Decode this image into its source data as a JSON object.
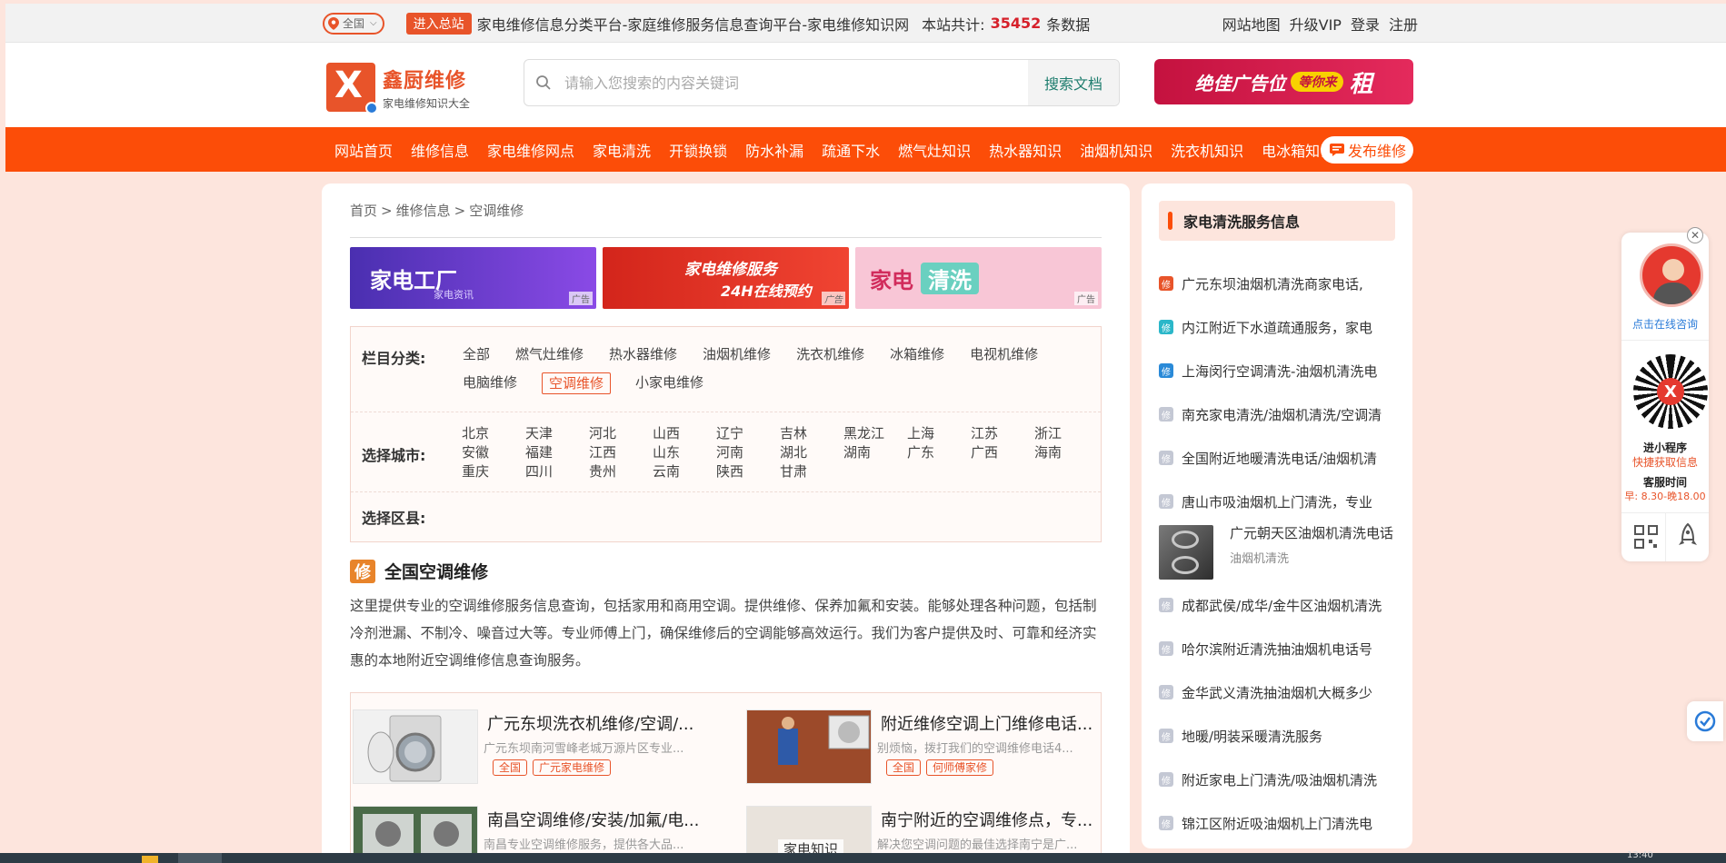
{
  "topbar": {
    "region": "全国",
    "enter_label": "进入总站",
    "description": "家电维修信息分类平台-家庭维修服务信息查询平台-家电维修知识网",
    "count_label": "本站共计:",
    "count_value": "35452",
    "count_unit": "条数据",
    "links": [
      "网站地图",
      "升级VIP",
      "登录",
      "注册"
    ]
  },
  "header": {
    "logo_title": "鑫厨维修",
    "logo_sub": "家电维修知识大全",
    "search_placeholder": "请输入您搜索的内容关键词",
    "search_button": "搜索文档",
    "ad_text_1": "绝佳广告位",
    "ad_text_2": "等你来",
    "ad_text_3": "租"
  },
  "nav": {
    "items": [
      "网站首页",
      "维修信息",
      "家电维修网点",
      "家电清洗",
      "开锁换锁",
      "防水补漏",
      "疏通下水",
      "燃气灶知识",
      "热水器知识",
      "油烟机知识",
      "洗衣机知识",
      "电冰箱知识"
    ],
    "publish": "发布维修"
  },
  "breadcrumb": [
    "首页",
    "维修信息",
    "空调维修"
  ],
  "ads": {
    "ad1_title": "家电工厂",
    "ad1_sub": "家电资讯",
    "ad2_line1": "家电维修服务",
    "ad2_line2": "24H在线预约",
    "ad3_a": "家电",
    "ad3_b": "清洗",
    "tag": "广告"
  },
  "filter": {
    "category_label": "栏目分类:",
    "categories": [
      "全部",
      "燃气灶维修",
      "热水器维修",
      "油烟机维修",
      "洗衣机维修",
      "冰箱维修",
      "电视机维修",
      "电脑维修",
      "空调维修",
      "小家电维修"
    ],
    "active_category": "空调维修",
    "city_label": "选择城市:",
    "cities": [
      "北京",
      "天津",
      "河北",
      "山西",
      "辽宁",
      "吉林",
      "黑龙江",
      "上海",
      "江苏",
      "浙江",
      "安徽",
      "福建",
      "江西",
      "山东",
      "河南",
      "湖北",
      "湖南",
      "广东",
      "广西",
      "海南",
      "重庆",
      "四川",
      "贵州",
      "云南",
      "陕西",
      "甘肃"
    ],
    "district_label": "选择区县:"
  },
  "section": {
    "badge": "修",
    "title": "全国空调维修",
    "intro": "这里提供专业的空调维修服务信息查询，包括家用和商用空调。提供维修、保养加氟和安装。能够处理各种问题，包括制冷剂泄漏、不制冷、噪音过大等。专业师傅上门，确保维修后的空调能够高效运行。我们为客户提供及时、可靠和经济实惠的本地附近空调维修信息查询服务。"
  },
  "listings": [
    {
      "title": "广元东坝洗衣机维修/空调/...",
      "desc": "广元东坝南河雪峰老城万源片区专业...",
      "tags": [
        "全国",
        "广元家电维修"
      ]
    },
    {
      "title": "附近维修空调上门维修电话...",
      "desc": "别烦恼，拨打我们的空调维修电话4...",
      "tags": [
        "全国",
        "何师傅家修"
      ]
    },
    {
      "title": "南昌空调维修/安装/加氟/电...",
      "desc": "南昌专业空调维修服务，提供各大品...",
      "tags": []
    },
    {
      "title": "南宁附近的空调维修点，专...",
      "desc": "解决您空调问题的最佳选择南宁是广...",
      "thumb_label": "家电知识",
      "tags": []
    }
  ],
  "sidebar": {
    "title": "家电清洗服务信息",
    "items": [
      {
        "text": "广元东坝油烟机清洗商家电话,",
        "color": "#e8542a"
      },
      {
        "text": "内江附近下水道疏通服务，家电",
        "color": "#2bb7c9"
      },
      {
        "text": "上海闵行空调清洗-油烟机清洗电",
        "color": "#2a8ad8"
      },
      {
        "text": "南充家电清洗/油烟机清洗/空调清",
        "color": "#c4c8d4"
      },
      {
        "text": "全国附近地暖清洗电话/油烟机清",
        "color": "#c4c8d4"
      },
      {
        "text": "唐山市吸油烟机上门清洗，专业",
        "color": "#c4c8d4"
      }
    ],
    "feature": {
      "title": "广元朝天区油烟机清洗电话",
      "category": "油烟机清洗"
    },
    "items2": [
      {
        "text": "成都武侯/成华/金牛区油烟机清洗",
        "color": "#c4c8d4"
      },
      {
        "text": "哈尔滨附近清洗抽油烟机电话号",
        "color": "#c4c8d4"
      },
      {
        "text": "金华武义清洗抽油烟机大概多少",
        "color": "#c4c8d4"
      },
      {
        "text": "地暖/明装采暖清洗服务",
        "color": "#c4c8d4"
      },
      {
        "text": "附近家电上门清洗/吸油烟机清洗",
        "color": "#c4c8d4"
      },
      {
        "text": "锦江区附近吸油烟机上门清洗电",
        "color": "#c4c8d4"
      }
    ],
    "icon_char": "修"
  },
  "float_panel": {
    "online": "点击在线咨询",
    "mp_title": "进小程序",
    "mp_sub": "快捷获取信息",
    "service_title": "客服时间",
    "service_hours": "早: 8.30-晚18.00"
  },
  "taskbar": {
    "clock": "13:40"
  }
}
